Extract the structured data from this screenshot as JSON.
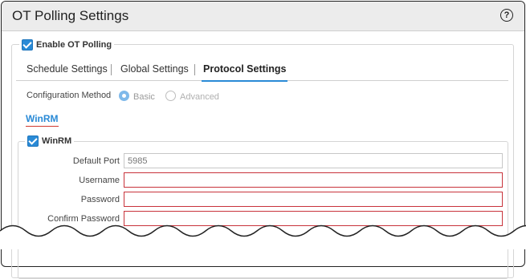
{
  "window": {
    "title": "OT Polling Settings",
    "help_icon": "question-circle-icon",
    "help_glyph": "?"
  },
  "enable_ot_polling": {
    "label": "Enable OT Polling",
    "checked": true
  },
  "tabs": [
    {
      "label": "Schedule Settings",
      "active": false
    },
    {
      "label": "Global Settings",
      "active": false
    },
    {
      "label": "Protocol Settings",
      "active": true
    }
  ],
  "config_method": {
    "label": "Configuration Method",
    "options": [
      {
        "label": "Basic",
        "selected": true
      },
      {
        "label": "Advanced",
        "selected": false
      }
    ]
  },
  "section_link": "WinRM",
  "winrm": {
    "legend": "WinRM",
    "checked": true,
    "fields": {
      "default_port": {
        "label": "Default Port",
        "value": "5985"
      },
      "username": {
        "label": "Username",
        "value": ""
      },
      "password": {
        "label": "Password",
        "value": ""
      },
      "confirm_password": {
        "label": "Confirm Password",
        "value": ""
      }
    }
  },
  "colors": {
    "accent": "#2a8ad6",
    "error_border": "#c8333b",
    "titlebar_bg": "#ececec"
  }
}
